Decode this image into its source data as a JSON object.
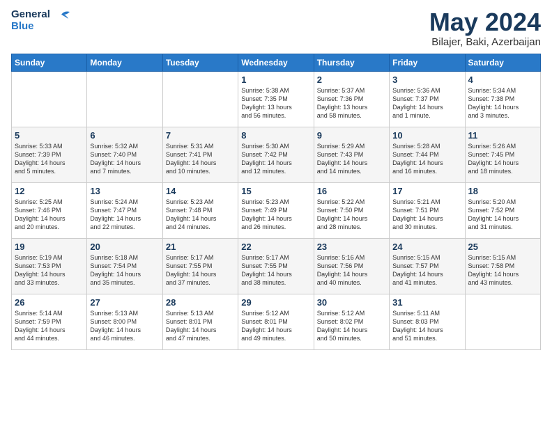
{
  "header": {
    "logo_line1": "General",
    "logo_line2": "Blue",
    "month": "May 2024",
    "location": "Bilajer, Baki, Azerbaijan"
  },
  "weekdays": [
    "Sunday",
    "Monday",
    "Tuesday",
    "Wednesday",
    "Thursday",
    "Friday",
    "Saturday"
  ],
  "weeks": [
    [
      {
        "day": "",
        "info": ""
      },
      {
        "day": "",
        "info": ""
      },
      {
        "day": "",
        "info": ""
      },
      {
        "day": "1",
        "info": "Sunrise: 5:38 AM\nSunset: 7:35 PM\nDaylight: 13 hours\nand 56 minutes."
      },
      {
        "day": "2",
        "info": "Sunrise: 5:37 AM\nSunset: 7:36 PM\nDaylight: 13 hours\nand 58 minutes."
      },
      {
        "day": "3",
        "info": "Sunrise: 5:36 AM\nSunset: 7:37 PM\nDaylight: 14 hours\nand 1 minute."
      },
      {
        "day": "4",
        "info": "Sunrise: 5:34 AM\nSunset: 7:38 PM\nDaylight: 14 hours\nand 3 minutes."
      }
    ],
    [
      {
        "day": "5",
        "info": "Sunrise: 5:33 AM\nSunset: 7:39 PM\nDaylight: 14 hours\nand 5 minutes."
      },
      {
        "day": "6",
        "info": "Sunrise: 5:32 AM\nSunset: 7:40 PM\nDaylight: 14 hours\nand 7 minutes."
      },
      {
        "day": "7",
        "info": "Sunrise: 5:31 AM\nSunset: 7:41 PM\nDaylight: 14 hours\nand 10 minutes."
      },
      {
        "day": "8",
        "info": "Sunrise: 5:30 AM\nSunset: 7:42 PM\nDaylight: 14 hours\nand 12 minutes."
      },
      {
        "day": "9",
        "info": "Sunrise: 5:29 AM\nSunset: 7:43 PM\nDaylight: 14 hours\nand 14 minutes."
      },
      {
        "day": "10",
        "info": "Sunrise: 5:28 AM\nSunset: 7:44 PM\nDaylight: 14 hours\nand 16 minutes."
      },
      {
        "day": "11",
        "info": "Sunrise: 5:26 AM\nSunset: 7:45 PM\nDaylight: 14 hours\nand 18 minutes."
      }
    ],
    [
      {
        "day": "12",
        "info": "Sunrise: 5:25 AM\nSunset: 7:46 PM\nDaylight: 14 hours\nand 20 minutes."
      },
      {
        "day": "13",
        "info": "Sunrise: 5:24 AM\nSunset: 7:47 PM\nDaylight: 14 hours\nand 22 minutes."
      },
      {
        "day": "14",
        "info": "Sunrise: 5:23 AM\nSunset: 7:48 PM\nDaylight: 14 hours\nand 24 minutes."
      },
      {
        "day": "15",
        "info": "Sunrise: 5:23 AM\nSunset: 7:49 PM\nDaylight: 14 hours\nand 26 minutes."
      },
      {
        "day": "16",
        "info": "Sunrise: 5:22 AM\nSunset: 7:50 PM\nDaylight: 14 hours\nand 28 minutes."
      },
      {
        "day": "17",
        "info": "Sunrise: 5:21 AM\nSunset: 7:51 PM\nDaylight: 14 hours\nand 30 minutes."
      },
      {
        "day": "18",
        "info": "Sunrise: 5:20 AM\nSunset: 7:52 PM\nDaylight: 14 hours\nand 31 minutes."
      }
    ],
    [
      {
        "day": "19",
        "info": "Sunrise: 5:19 AM\nSunset: 7:53 PM\nDaylight: 14 hours\nand 33 minutes."
      },
      {
        "day": "20",
        "info": "Sunrise: 5:18 AM\nSunset: 7:54 PM\nDaylight: 14 hours\nand 35 minutes."
      },
      {
        "day": "21",
        "info": "Sunrise: 5:17 AM\nSunset: 7:55 PM\nDaylight: 14 hours\nand 37 minutes."
      },
      {
        "day": "22",
        "info": "Sunrise: 5:17 AM\nSunset: 7:55 PM\nDaylight: 14 hours\nand 38 minutes."
      },
      {
        "day": "23",
        "info": "Sunrise: 5:16 AM\nSunset: 7:56 PM\nDaylight: 14 hours\nand 40 minutes."
      },
      {
        "day": "24",
        "info": "Sunrise: 5:15 AM\nSunset: 7:57 PM\nDaylight: 14 hours\nand 41 minutes."
      },
      {
        "day": "25",
        "info": "Sunrise: 5:15 AM\nSunset: 7:58 PM\nDaylight: 14 hours\nand 43 minutes."
      }
    ],
    [
      {
        "day": "26",
        "info": "Sunrise: 5:14 AM\nSunset: 7:59 PM\nDaylight: 14 hours\nand 44 minutes."
      },
      {
        "day": "27",
        "info": "Sunrise: 5:13 AM\nSunset: 8:00 PM\nDaylight: 14 hours\nand 46 minutes."
      },
      {
        "day": "28",
        "info": "Sunrise: 5:13 AM\nSunset: 8:01 PM\nDaylight: 14 hours\nand 47 minutes."
      },
      {
        "day": "29",
        "info": "Sunrise: 5:12 AM\nSunset: 8:01 PM\nDaylight: 14 hours\nand 49 minutes."
      },
      {
        "day": "30",
        "info": "Sunrise: 5:12 AM\nSunset: 8:02 PM\nDaylight: 14 hours\nand 50 minutes."
      },
      {
        "day": "31",
        "info": "Sunrise: 5:11 AM\nSunset: 8:03 PM\nDaylight: 14 hours\nand 51 minutes."
      },
      {
        "day": "",
        "info": ""
      }
    ]
  ]
}
